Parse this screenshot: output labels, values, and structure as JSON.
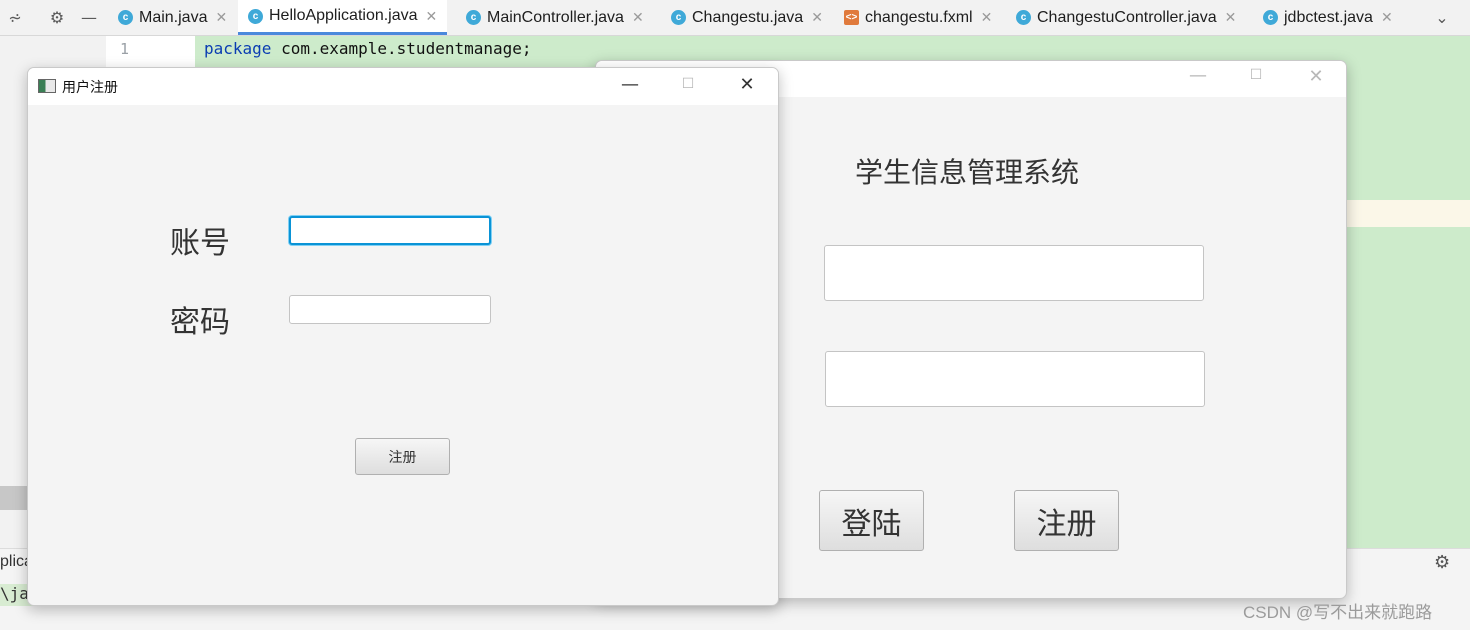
{
  "ide": {
    "tabs": [
      {
        "label": "Main.java",
        "icon": "c"
      },
      {
        "label": "HelloApplication.java",
        "icon": "c"
      },
      {
        "label": "MainController.java",
        "icon": "c"
      },
      {
        "label": "Changestu.java",
        "icon": "c"
      },
      {
        "label": "changestu.fxml",
        "icon": "fx"
      },
      {
        "label": "ChangestuController.java",
        "icon": "c"
      },
      {
        "label": "jdbctest.java",
        "icon": "c"
      }
    ],
    "line_number": "1",
    "code_keyword": "package",
    "code_rest": " com.example.studentmanage;",
    "run_tab_label": "plica",
    "run_path_text": "\\ja"
  },
  "register_window": {
    "title": "用户注册",
    "account_label": "账号",
    "password_label": "密码",
    "account_value": "",
    "password_value": "",
    "register_button": "注册"
  },
  "login_window": {
    "heading": "学生信息管理系统",
    "username_value": "",
    "password_value": "",
    "login_button": "登陆",
    "register_button": "注册"
  },
  "watermark": "CSDN @写不出来就跑路"
}
